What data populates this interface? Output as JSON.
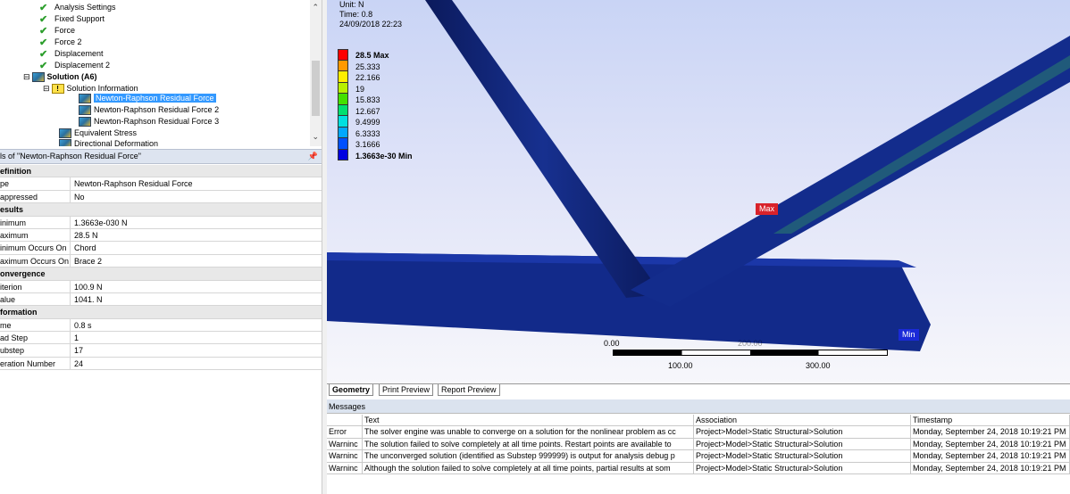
{
  "tree": {
    "items": [
      {
        "label": "Analysis Settings",
        "icon": "analysis-settings-icon"
      },
      {
        "label": "Fixed Support",
        "icon": "fixed-support-icon"
      },
      {
        "label": "Force",
        "icon": "force-icon"
      },
      {
        "label": "Force 2",
        "icon": "force-icon"
      },
      {
        "label": "Displacement",
        "icon": "displacement-icon"
      },
      {
        "label": "Displacement 2",
        "icon": "displacement-icon"
      },
      {
        "label": "Solution (A6)",
        "icon": "solution-icon"
      },
      {
        "label": "Solution Information",
        "icon": "warning-icon"
      },
      {
        "label": "Newton-Raphson Residual Force",
        "icon": "result-icon"
      },
      {
        "label": "Newton-Raphson Residual Force 2",
        "icon": "result-icon"
      },
      {
        "label": "Newton-Raphson Residual Force 3",
        "icon": "result-icon"
      },
      {
        "label": "Equivalent Stress",
        "icon": "result-icon"
      },
      {
        "label": "Directional Deformation",
        "icon": "result-icon"
      }
    ]
  },
  "details": {
    "title": "ls of \"Newton-Raphson Residual Force\"",
    "rows": [
      {
        "section": true,
        "key": "efinition"
      },
      {
        "key": "pe",
        "value": "Newton-Raphson Residual Force"
      },
      {
        "key": "appressed",
        "value": "No"
      },
      {
        "section": true,
        "key": "esults"
      },
      {
        "key": "inimum",
        "value": "1.3663e-030 N"
      },
      {
        "key": "aximum",
        "value": "28.5 N"
      },
      {
        "key": "inimum Occurs On",
        "value": "Chord"
      },
      {
        "key": "aximum Occurs On",
        "value": "Brace 2"
      },
      {
        "section": true,
        "key": "onvergence"
      },
      {
        "key": "iterion",
        "value": "100.9 N"
      },
      {
        "key": "alue",
        "value": "1041. N"
      },
      {
        "section": true,
        "key": "formation"
      },
      {
        "key": "me",
        "value": "0.8 s"
      },
      {
        "key": "ad Step",
        "value": "1"
      },
      {
        "key": "ubstep",
        "value": "17"
      },
      {
        "key": "eration Number",
        "value": "24"
      }
    ]
  },
  "viewport": {
    "unit": "Unit: N",
    "time": "Time: 0.8",
    "date": "24/09/2018 22:23",
    "legend": [
      {
        "label": "28.5 Max",
        "color": "#ff0000",
        "bold": true
      },
      {
        "label": "25.333",
        "color": "#ff9900"
      },
      {
        "label": "22.166",
        "color": "#ffee00"
      },
      {
        "label": "19",
        "color": "#b8f000"
      },
      {
        "label": "15.833",
        "color": "#44e000"
      },
      {
        "label": "12.667",
        "color": "#00e070"
      },
      {
        "label": "9.4999",
        "color": "#00e0e0"
      },
      {
        "label": "6.3333",
        "color": "#00a8ff"
      },
      {
        "label": "3.1666",
        "color": "#0050ff"
      },
      {
        "label": "1.3663e-30 Min",
        "color": "#0000e0",
        "bold": true
      }
    ],
    "max_tag": "Max",
    "min_tag": "Min",
    "scale": {
      "l0": "0.00",
      "l1": "100.00",
      "l2": "300.00",
      "mid": "200.00"
    }
  },
  "tabs": [
    "Geometry",
    "Print Preview",
    "Report Preview"
  ],
  "messages": {
    "title": "Messages",
    "headers": [
      "",
      "Text",
      "Association",
      "Timestamp"
    ],
    "rows": [
      [
        "Error",
        "The solver engine was unable to converge on a solution for the nonlinear problem as cc",
        "Project>Model>Static Structural>Solution",
        "Monday, September 24, 2018 10:19:21 PM"
      ],
      [
        "Warninc",
        "The solution failed to solve completely at all time points. Restart points are available to",
        "Project>Model>Static Structural>Solution",
        "Monday, September 24, 2018 10:19:21 PM"
      ],
      [
        "Warninc",
        "The unconverged solution (identified as Substep 999999) is output for analysis debug p",
        "Project>Model>Static Structural>Solution",
        "Monday, September 24, 2018 10:19:21 PM"
      ],
      [
        "Warninc",
        "Although the solution failed to solve completely at all time points, partial results at som",
        "Project>Model>Static Structural>Solution",
        "Monday, September 24, 2018 10:19:21 PM"
      ]
    ]
  }
}
